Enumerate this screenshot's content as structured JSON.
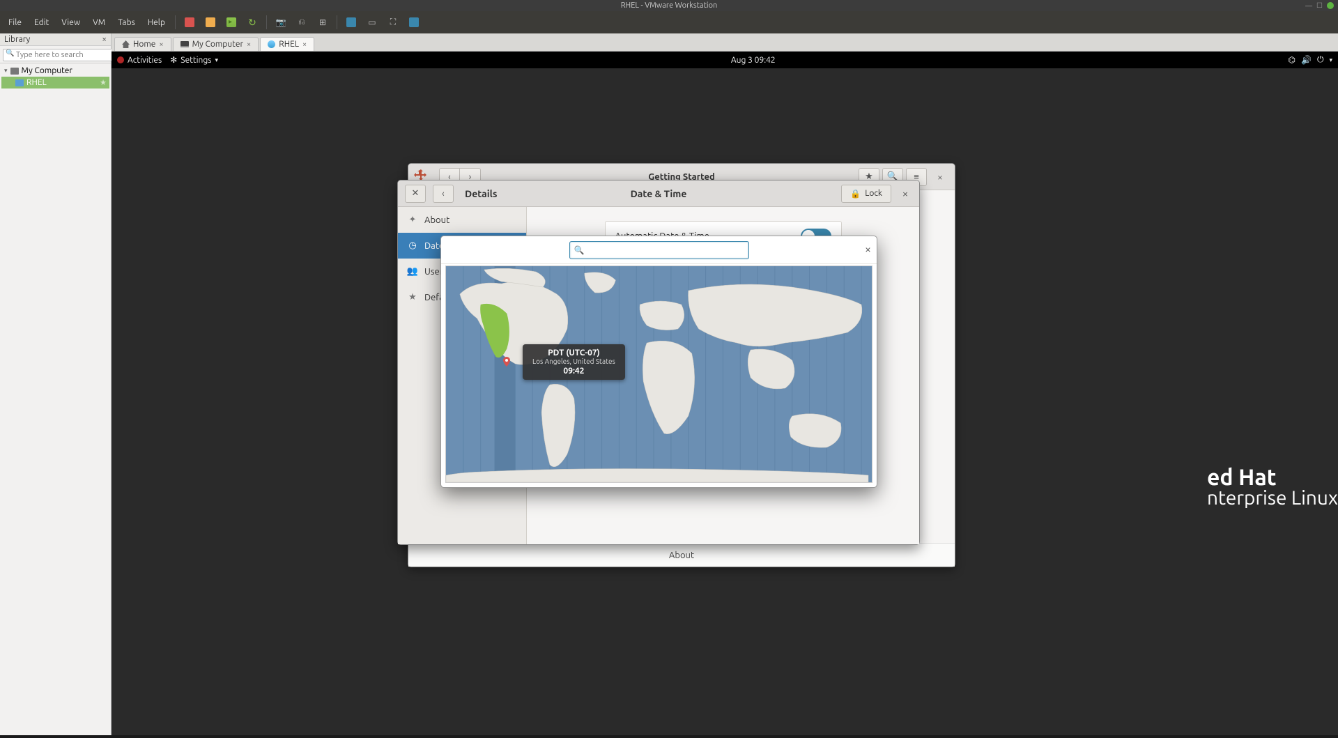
{
  "window": {
    "title": "RHEL - VMware Workstation"
  },
  "menu": {
    "file": "File",
    "edit": "Edit",
    "view": "View",
    "vm": "VM",
    "tabs": "Tabs",
    "help": "Help"
  },
  "library": {
    "title": "Library",
    "search_placeholder": "Type here to search",
    "items": [
      {
        "label": "My Computer"
      },
      {
        "label": "RHEL"
      }
    ]
  },
  "tabs": [
    {
      "label": "Home"
    },
    {
      "label": "My Computer"
    },
    {
      "label": "RHEL"
    }
  ],
  "gnome_bar": {
    "activities": "Activities",
    "settings": "Settings",
    "datetime": "Aug 3  09:42"
  },
  "getting_started": {
    "title": "Getting Started",
    "footer": "About"
  },
  "details": {
    "header_left": "Details",
    "header_center": "Date & Time",
    "lock": "Lock",
    "sidebar": {
      "about": "About",
      "date": "Date & Time",
      "users": "Users",
      "default": "Default Applications"
    },
    "row1": "Automatic Date & Time"
  },
  "timezone": {
    "tz_label": "PDT (UTC-07)",
    "location": "Los Angeles, United States",
    "time": "09:42"
  },
  "rhel_brand": {
    "line1": "ed Hat",
    "line2": "nterprise Linux"
  }
}
